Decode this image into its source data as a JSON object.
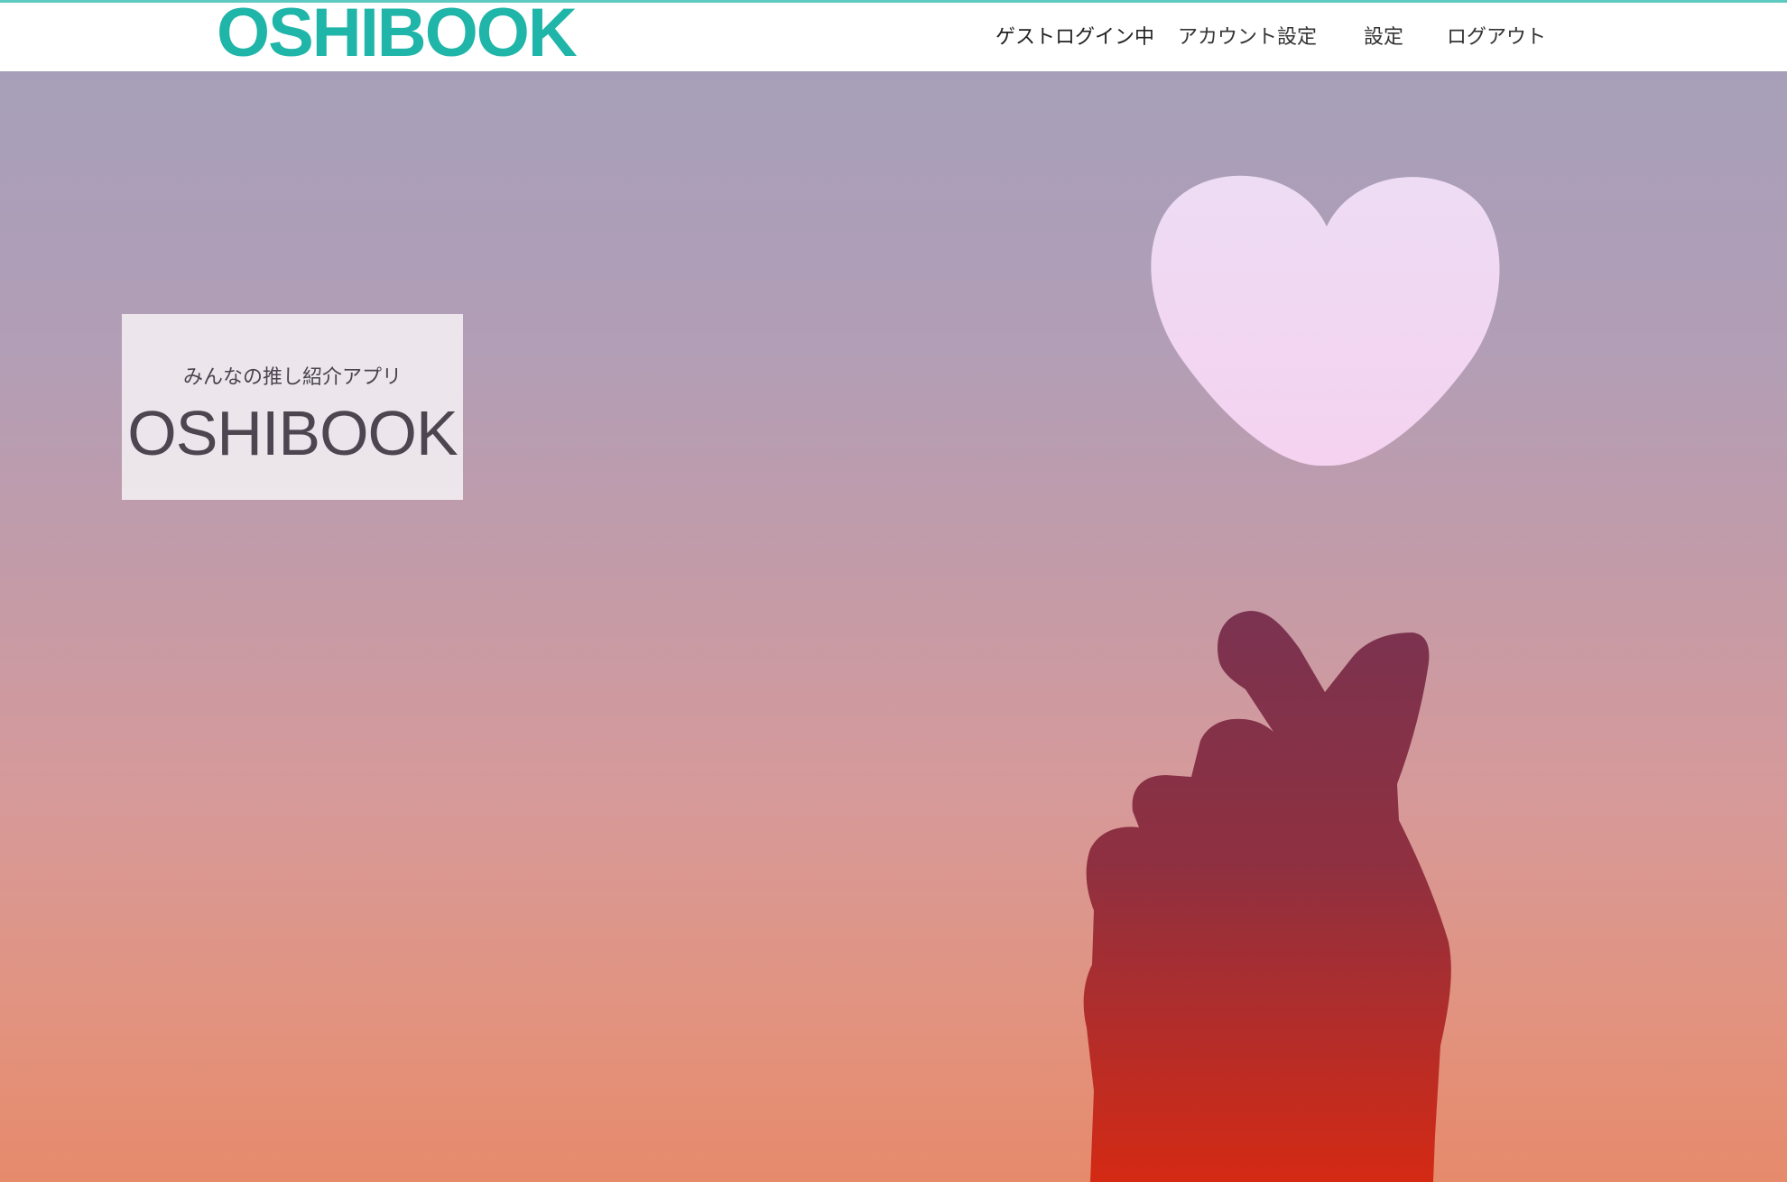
{
  "navbar": {
    "brand": "OSHIBOOK",
    "status": "ゲストログイン中",
    "account_settings": "アカウント設定",
    "settings": "設定",
    "logout": "ログアウト"
  },
  "hero": {
    "subtitle": "みんなの推し紹介アプリ",
    "title": "OSHIBOOK"
  },
  "colors": {
    "brand": "#1fb5a8",
    "nav_border": "#5ec9c0",
    "heart": "#f2d6f2",
    "hand_top": "#7a3350",
    "hand_bottom": "#d42a14"
  }
}
